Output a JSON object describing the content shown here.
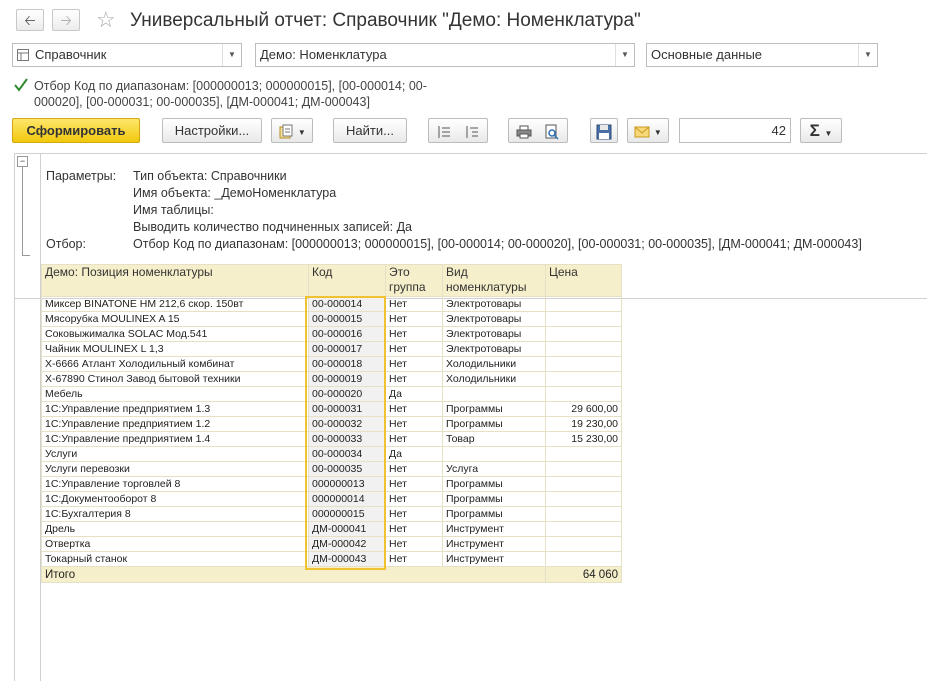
{
  "window": {
    "title": "Универсальный отчет: Справочник \"Демо: Номенклатура\""
  },
  "selectors": {
    "object_type": "Справочник",
    "object_name": "Демо: Номенклатура",
    "variant": "Основные данные"
  },
  "filter": {
    "checked": true,
    "text": "Отбор Код по диапазонам: [000000013; 000000015], [00-000014; 00-000020], [00-000031; 00-000035], [ДМ-000041; ДМ-000043]"
  },
  "toolbar": {
    "generate_label": "Сформировать",
    "settings_label": "Настройки...",
    "find_label": "Найти...",
    "number_value": "42",
    "sum_icon": "Σ"
  },
  "report": {
    "params_label": "Параметры:",
    "params": [
      "Тип объекта: Справочники",
      "Имя объекта: _ДемоНоменклатура",
      "Имя таблицы:",
      "Выводить количество подчиненных записей: Да"
    ],
    "filter_label": "Отбор:",
    "filter_value": "Отбор Код по диапазонам: [000000013; 000000015], [00-000014; 00-000020], [00-000031; 00-000035], [ДМ-000041; ДМ-000043]",
    "columns": [
      "Демо: Позиция номенклатуры",
      "Код",
      "Это группа",
      "Вид номенклатуры",
      "Цена"
    ],
    "rows": [
      [
        "Миксер BINATONE HM 212,6 скор. 150вт",
        "00-000014",
        "Нет",
        "Электротовары",
        ""
      ],
      [
        "Мясорубка MOULINEX A 15",
        "00-000015",
        "Нет",
        "Электротовары",
        ""
      ],
      [
        "Соковыжималка  SOLAC  Мод.541",
        "00-000016",
        "Нет",
        "Электротовары",
        ""
      ],
      [
        "Чайник MOULINEX L 1,3",
        "00-000017",
        "Нет",
        "Электротовары",
        ""
      ],
      [
        "Х-6666 Атлант Холодильный комбинат",
        "00-000018",
        "Нет",
        "Холодильники",
        ""
      ],
      [
        "Х-67890 Стинол Завод бытовой техники",
        "00-000019",
        "Нет",
        "Холодильники",
        ""
      ],
      [
        "Мебель",
        "00-000020",
        "Да",
        "",
        ""
      ],
      [
        "1С:Управление предприятием 1.3",
        "00-000031",
        "Нет",
        "Программы",
        "29 600,00"
      ],
      [
        "1С:Управление предприятием 1.2",
        "00-000032",
        "Нет",
        "Программы",
        "19 230,00"
      ],
      [
        "1С:Управление предприятием 1.4",
        "00-000033",
        "Нет",
        "Товар",
        "15 230,00"
      ],
      [
        "Услуги",
        "00-000034",
        "Да",
        "",
        ""
      ],
      [
        "Услуги перевозки",
        "00-000035",
        "Нет",
        "Услуга",
        ""
      ],
      [
        "1С:Управление торговлей 8",
        "000000013",
        "Нет",
        "Программы",
        ""
      ],
      [
        "1С:Документооборот 8",
        "000000014",
        "Нет",
        "Программы",
        ""
      ],
      [
        "1С:Бухгалтерия 8",
        "000000015",
        "Нет",
        "Программы",
        ""
      ],
      [
        "Дрель",
        "ДМ-000041",
        "Нет",
        "Инструмент",
        ""
      ],
      [
        "Отвертка",
        "ДМ-000042",
        "Нет",
        "Инструмент",
        ""
      ],
      [
        "Токарный станок",
        "ДМ-000043",
        "Нет",
        "Инструмент",
        ""
      ]
    ],
    "total_label": "Итого",
    "total_value": "64 060"
  },
  "colors": {
    "accent_yellow": "#f2c80c",
    "header_fill": "#f6efcb",
    "highlight_border": "#f0c232"
  }
}
